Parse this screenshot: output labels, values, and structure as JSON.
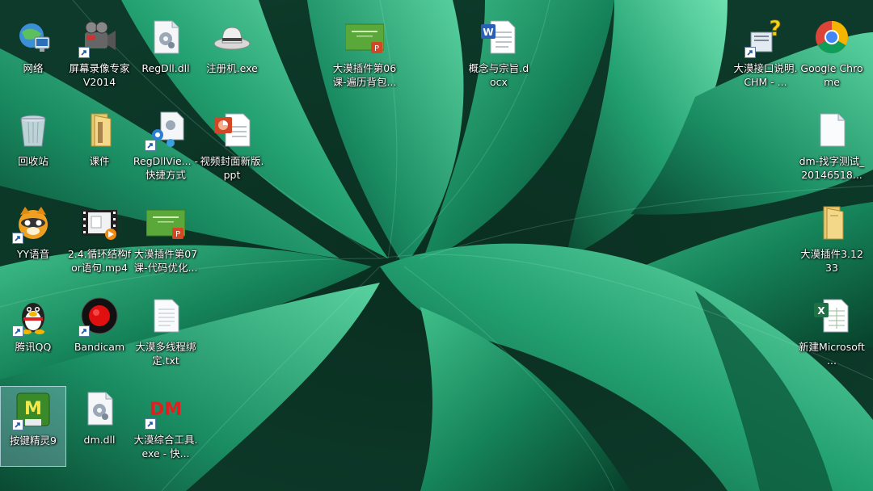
{
  "desktop": {
    "icons": [
      {
        "id": "network",
        "label": "网络",
        "icon": "network-icon"
      },
      {
        "id": "screen-recorder",
        "label": "屏幕录像专家V2014",
        "icon": "video-camera-icon"
      },
      {
        "id": "regdll",
        "label": "RegDll.dll",
        "icon": "dll-file-icon"
      },
      {
        "id": "register-exe",
        "label": "注册机.exe",
        "icon": "hat-icon"
      },
      {
        "id": "lesson06",
        "label": "大漠插件第06课-遍历背包...",
        "icon": "ppt-slide-icon"
      },
      {
        "id": "concept-doc",
        "label": "概念与宗旨.docx",
        "icon": "word-doc-icon"
      },
      {
        "id": "dm-chm",
        "label": "大漠接口说明.CHM - ...",
        "icon": "help-chm-icon"
      },
      {
        "id": "chrome",
        "label": "Google Chrome",
        "icon": "chrome-icon"
      },
      {
        "id": "recycle-bin",
        "label": "回收站",
        "icon": "recycle-bin-icon"
      },
      {
        "id": "courseware",
        "label": "课件",
        "icon": "folder-icon"
      },
      {
        "id": "regdllview",
        "label": "RegDllVie... - 快捷方式",
        "icon": "regdllview-icon"
      },
      {
        "id": "video-cover-ppt",
        "label": "视频封面新版.ppt",
        "icon": "ppt-file-icon"
      },
      {
        "id": "dm-find-text",
        "label": "dm-找字测试_20146518...",
        "icon": "blank-file-icon"
      },
      {
        "id": "yy",
        "label": "YY语音",
        "icon": "yy-raccoon-icon"
      },
      {
        "id": "loop-mp4",
        "label": "2.4.循环结构for语句.mp4",
        "icon": "video-file-icon"
      },
      {
        "id": "lesson07",
        "label": "大漠插件第07课-代码优化...",
        "icon": "ppt-slide-icon"
      },
      {
        "id": "dm-plugin-folder",
        "label": "大漠插件3.1233",
        "icon": "folder-icon"
      },
      {
        "id": "qq",
        "label": "腾讯QQ",
        "icon": "penguin-icon"
      },
      {
        "id": "bandicam",
        "label": "Bandicam",
        "icon": "record-button-icon"
      },
      {
        "id": "multithread-txt",
        "label": "大漠多线程绑定.txt",
        "icon": "text-file-icon"
      },
      {
        "id": "new-excel",
        "label": "新建Microsoft ...",
        "icon": "excel-file-icon"
      },
      {
        "id": "keyboard-wizard",
        "label": "按键精灵9",
        "icon": "keyboard-wizard-icon"
      },
      {
        "id": "dm-dll",
        "label": "dm.dll",
        "icon": "dll-file-icon"
      },
      {
        "id": "dm-tools",
        "label": "大漠综合工具.exe - 快...",
        "icon": "dm-logo-icon"
      }
    ]
  },
  "colors": {
    "label_text": "#ffffff",
    "selection": "#b4d2f0",
    "leaf_dark": "#0a3324",
    "leaf_mid": "#1e8a60",
    "leaf_light": "#5fd3a0"
  }
}
